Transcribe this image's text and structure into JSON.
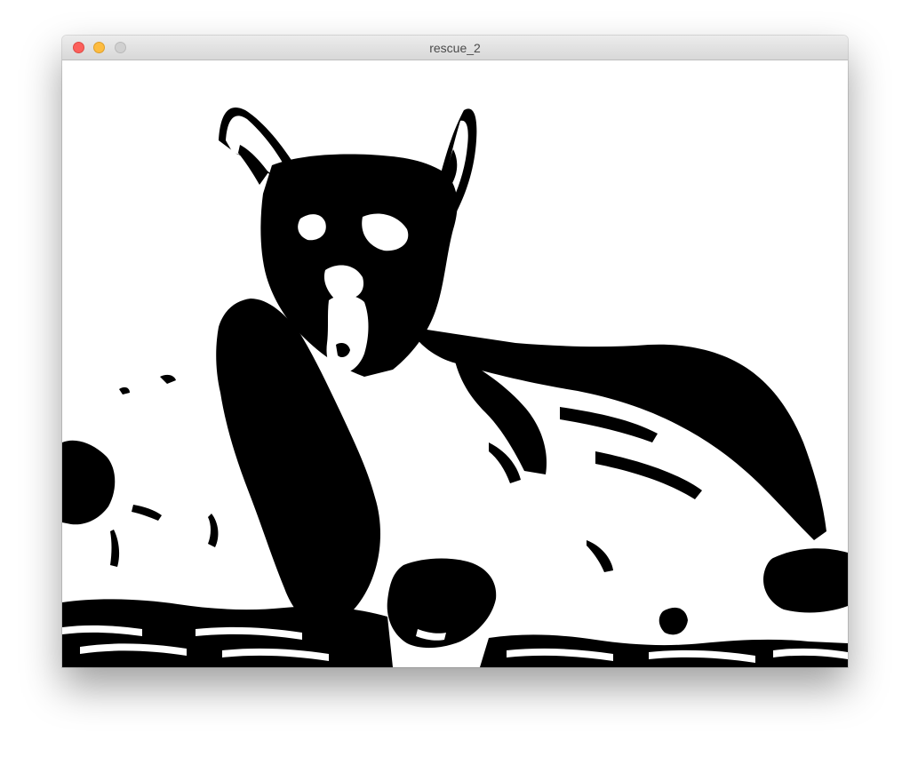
{
  "window": {
    "title": "rescue_2",
    "controls": {
      "close": "close-button",
      "minimize": "minimize-button",
      "zoom": "zoom-button"
    }
  },
  "image": {
    "subject_icon": "thresholded-corgi-image",
    "foreground_color": "#000000",
    "background_color": "#ffffff"
  }
}
